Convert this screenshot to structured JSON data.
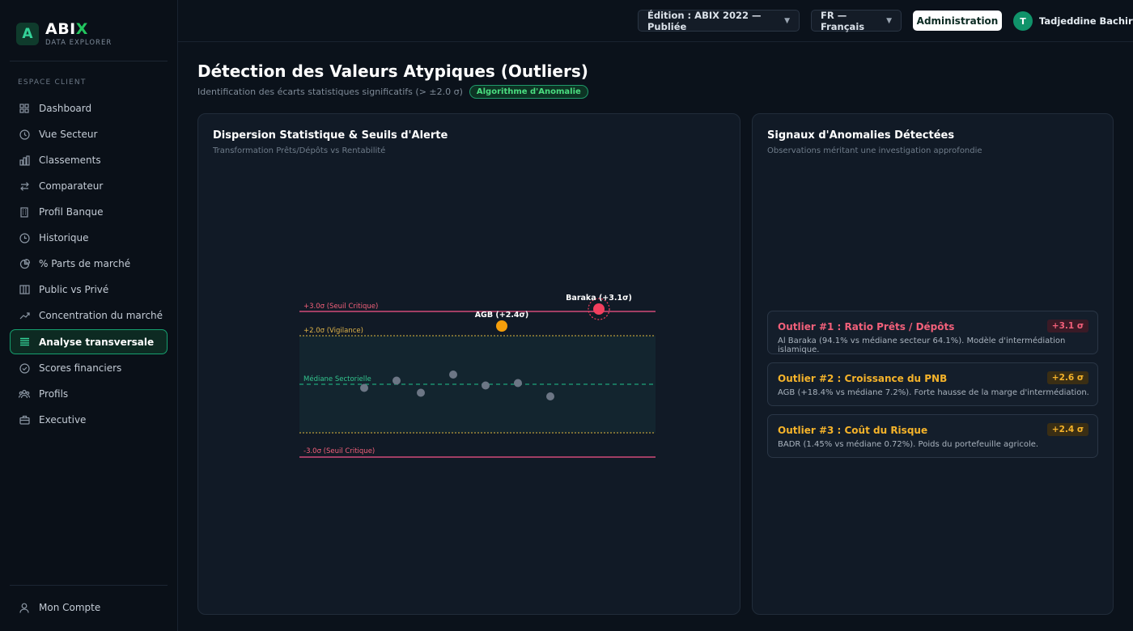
{
  "sidebar": {
    "brand_name_main": "ABI",
    "brand_name_accent": "X",
    "brand_sub": "DATA EXPLORER",
    "section": "ESPACE CLIENT",
    "items": [
      {
        "label": "Dashboard",
        "icon": "grid-icon"
      },
      {
        "label": "Vue Secteur",
        "icon": "clock-icon"
      },
      {
        "label": "Classements",
        "icon": "bar-chart-icon"
      },
      {
        "label": "Comparateur",
        "icon": "swap-icon"
      },
      {
        "label": "Profil Banque",
        "icon": "building-icon"
      },
      {
        "label": "Historique",
        "icon": "history-icon"
      },
      {
        "label": "% Parts de marché",
        "icon": "pie-icon"
      },
      {
        "label": "Public vs Privé",
        "icon": "columns-icon"
      },
      {
        "label": "Concentration du marché",
        "icon": "trend-icon"
      },
      {
        "label": "Analyse transversale",
        "icon": "list-icon",
        "active": true
      },
      {
        "label": "Scores financiers",
        "icon": "check-circle-icon"
      },
      {
        "label": "Profils",
        "icon": "users-icon"
      },
      {
        "label": "Executive",
        "icon": "briefcase-icon"
      }
    ],
    "account_label": "Mon Compte"
  },
  "header": {
    "edition": "Édition : ABIX 2022 — Publiée",
    "language": "FR — Français",
    "admin": "Administration",
    "avatar_initial": "T",
    "user_name": "Tadjeddine Bachir"
  },
  "page": {
    "title": "Détection des Valeurs Atypiques (Outliers)",
    "subtitle": "Identification des écarts statistiques significatifs (> ±2.0 σ)",
    "badge": "Algorithme d'Anomalie"
  },
  "chart_card": {
    "title": "Dispersion Statistique & Seuils d'Alerte",
    "subtitle": "Transformation Prêts/Dépôts vs Rentabilité"
  },
  "chart_data": {
    "type": "scatter",
    "ylim": [
      -3.0,
      3.0
    ],
    "reference_lines": [
      {
        "y": 3.0,
        "label": "+3.0σ (Seuil Critique)",
        "color": "#d14a78",
        "style": "solid"
      },
      {
        "y": 2.0,
        "label": "+2.0σ (Vigilance)",
        "color": "#b89b3a",
        "style": "dotted"
      },
      {
        "y": 0.0,
        "label": "Médiane Sectorielle",
        "color": "#1fa57a",
        "style": "dashed"
      },
      {
        "y": -2.0,
        "label": "",
        "color": "#b89b3a",
        "style": "dotted"
      },
      {
        "y": -3.0,
        "label": "-3.0σ (Seuil Critique)",
        "color": "#d14a78",
        "style": "solid"
      }
    ],
    "points": [
      {
        "x": 2.0,
        "y": -0.15,
        "label": ""
      },
      {
        "x": 3.0,
        "y": 0.15,
        "label": ""
      },
      {
        "x": 3.75,
        "y": -0.35,
        "label": ""
      },
      {
        "x": 4.75,
        "y": 0.4,
        "label": ""
      },
      {
        "x": 5.75,
        "y": -0.05,
        "label": ""
      },
      {
        "x": 6.75,
        "y": 0.05,
        "label": ""
      },
      {
        "x": 7.75,
        "y": -0.5,
        "label": ""
      },
      {
        "x": 6.25,
        "y": 2.4,
        "label": "AGB (+2.4σ)",
        "status": "warning"
      },
      {
        "x": 9.25,
        "y": 3.1,
        "label": "Baraka (+3.1σ)",
        "status": "critical"
      }
    ]
  },
  "anomaly_card": {
    "title": "Signaux d'Anomalies Détectées",
    "subtitle": "Observations méritant une investigation approfondie",
    "items": [
      {
        "title": "Outlier #1 : Ratio Prêts / Dépôts",
        "badge": "+3.1 σ",
        "desc": "Al Baraka (94.1% vs médiane secteur 64.1%). Modèle d'intermédiation islamique.",
        "level": "red"
      },
      {
        "title": "Outlier #2 : Croissance du PNB",
        "badge": "+2.6 σ",
        "desc": "AGB (+18.4% vs médiane 7.2%). Forte hausse de la marge d'intermédiation.",
        "level": "amber"
      },
      {
        "title": "Outlier #3 : Coût du Risque",
        "badge": "+2.4 σ",
        "desc": "BADR (1.45% vs médiane 0.72%). Poids du portefeuille agricole.",
        "level": "amber"
      }
    ]
  }
}
